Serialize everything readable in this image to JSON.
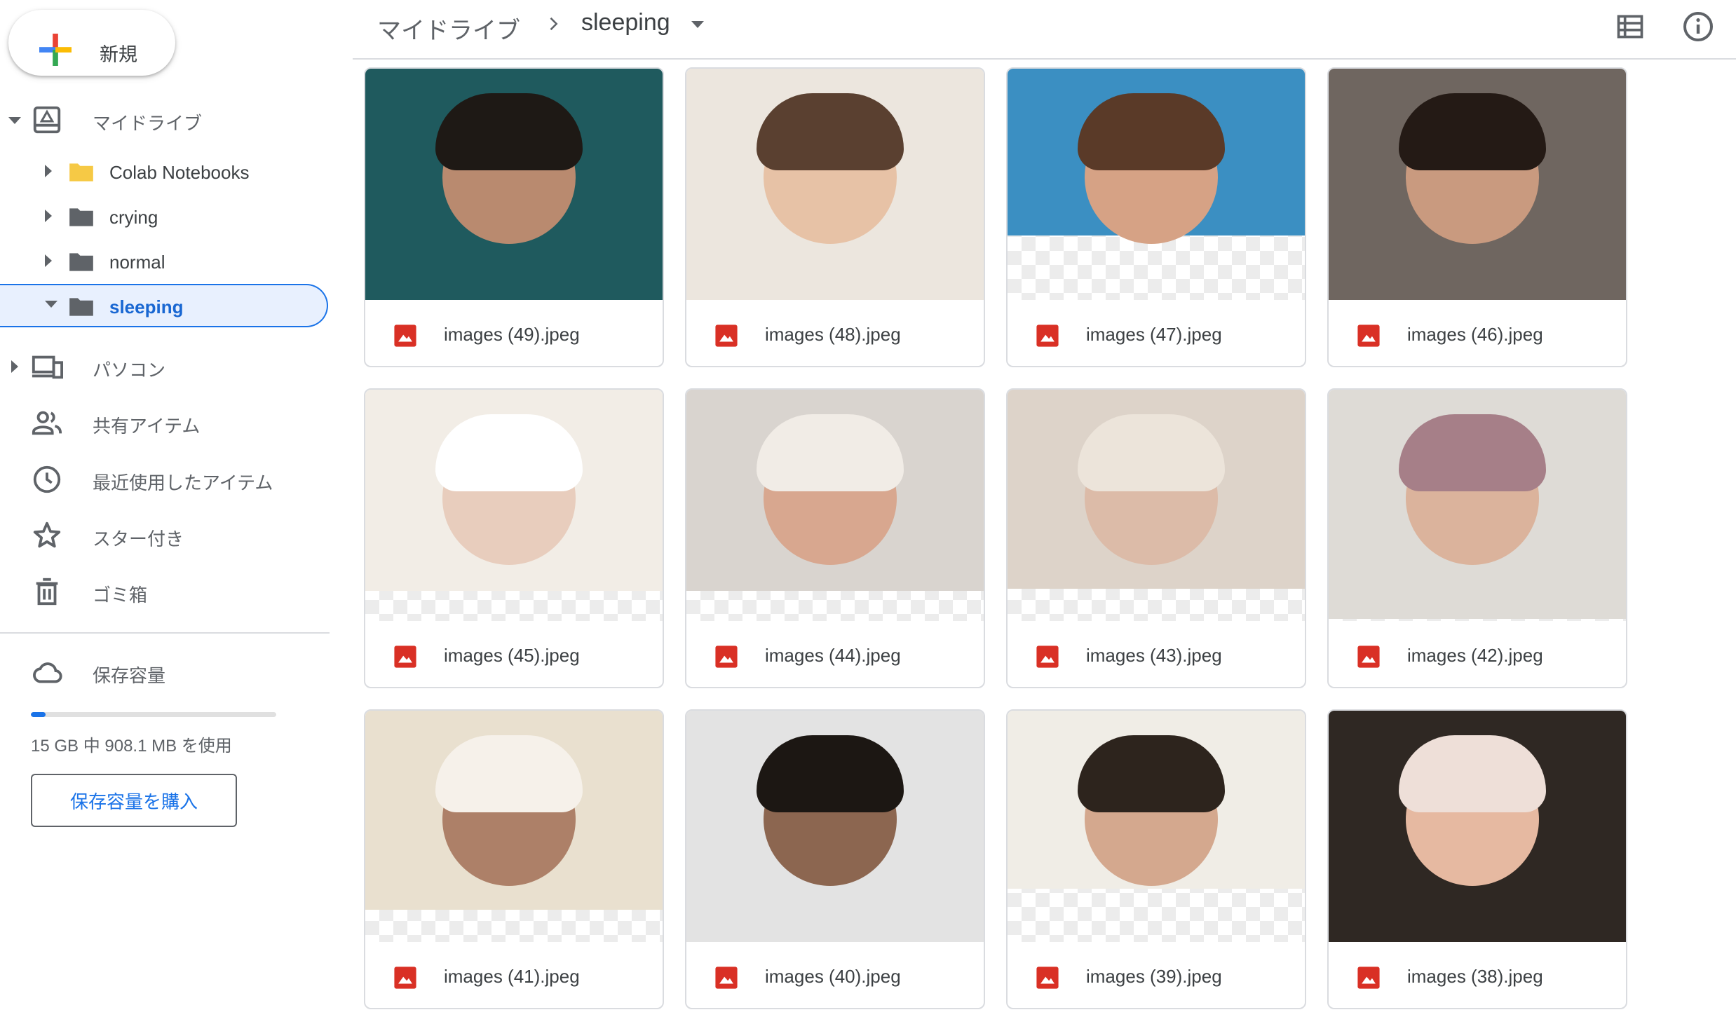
{
  "sidebar": {
    "new_label": "新規",
    "my_drive": "マイドライブ",
    "folders": [
      {
        "label": "Colab Notebooks",
        "color": "#f6c945"
      },
      {
        "label": "crying",
        "color": "#5f6368"
      },
      {
        "label": "normal",
        "color": "#5f6368"
      },
      {
        "label": "sleeping",
        "color": "#5f6368",
        "selected": true
      }
    ],
    "computers": "パソコン",
    "shared": "共有アイテム",
    "recent": "最近使用したアイテム",
    "starred": "スター付き",
    "trash": "ゴミ箱",
    "storage": {
      "label": "保存容量",
      "usage_text": "15 GB 中 908.1 MB を使用",
      "used_fraction": 0.06,
      "buy_label": "保存容量を購入"
    }
  },
  "header": {
    "root": "マイドライブ",
    "current": "sleeping"
  },
  "files": [
    {
      "name": "images (49).jpeg",
      "bg": "#1f5a5e",
      "skin": "#b98a6f",
      "hair": "#1e1915",
      "photo_ratio": 1.0
    },
    {
      "name": "images (48).jpeg",
      "bg": "#ece6de",
      "skin": "#e7c2a6",
      "hair": "#5a4030",
      "photo_ratio": 1.0
    },
    {
      "name": "images (47).jpeg",
      "bg": "#3b8fc2",
      "skin": "#d6a285",
      "hair": "#5a3a28",
      "photo_ratio": 0.72
    },
    {
      "name": "images (46).jpeg",
      "bg": "#6f6660",
      "skin": "#c99a7f",
      "hair": "#241a15",
      "photo_ratio": 1.0
    },
    {
      "name": "images (45).jpeg",
      "bg": "#f2ede6",
      "skin": "#e8cdbd",
      "hair": "#ffffff",
      "photo_ratio": 0.87
    },
    {
      "name": "images (44).jpeg",
      "bg": "#d9d4cf",
      "skin": "#d8a78f",
      "hair": "#f1ece6",
      "photo_ratio": 0.87
    },
    {
      "name": "images (43).jpeg",
      "bg": "#ddd3c9",
      "skin": "#dcbba8",
      "hair": "#ece4da",
      "photo_ratio": 0.86
    },
    {
      "name": "images (42).jpeg",
      "bg": "#dedbd6",
      "skin": "#dbb39c",
      "hair": "#a67f88",
      "photo_ratio": 0.99
    },
    {
      "name": "images (41).jpeg",
      "bg": "#e9e0cf",
      "skin": "#ad8068",
      "hair": "#f6f1ea",
      "photo_ratio": 0.86
    },
    {
      "name": "images (40).jpeg",
      "bg": "#e3e3e3",
      "skin": "#8c6650",
      "hair": "#1c1713",
      "photo_ratio": 1.0
    },
    {
      "name": "images (39).jpeg",
      "bg": "#f0ede6",
      "skin": "#d4a88e",
      "hair": "#2d241d",
      "photo_ratio": 0.77
    },
    {
      "name": "images (38).jpeg",
      "bg": "#2f2823",
      "skin": "#e6b9a1",
      "hair": "#eedfd8",
      "photo_ratio": 1.0
    }
  ]
}
